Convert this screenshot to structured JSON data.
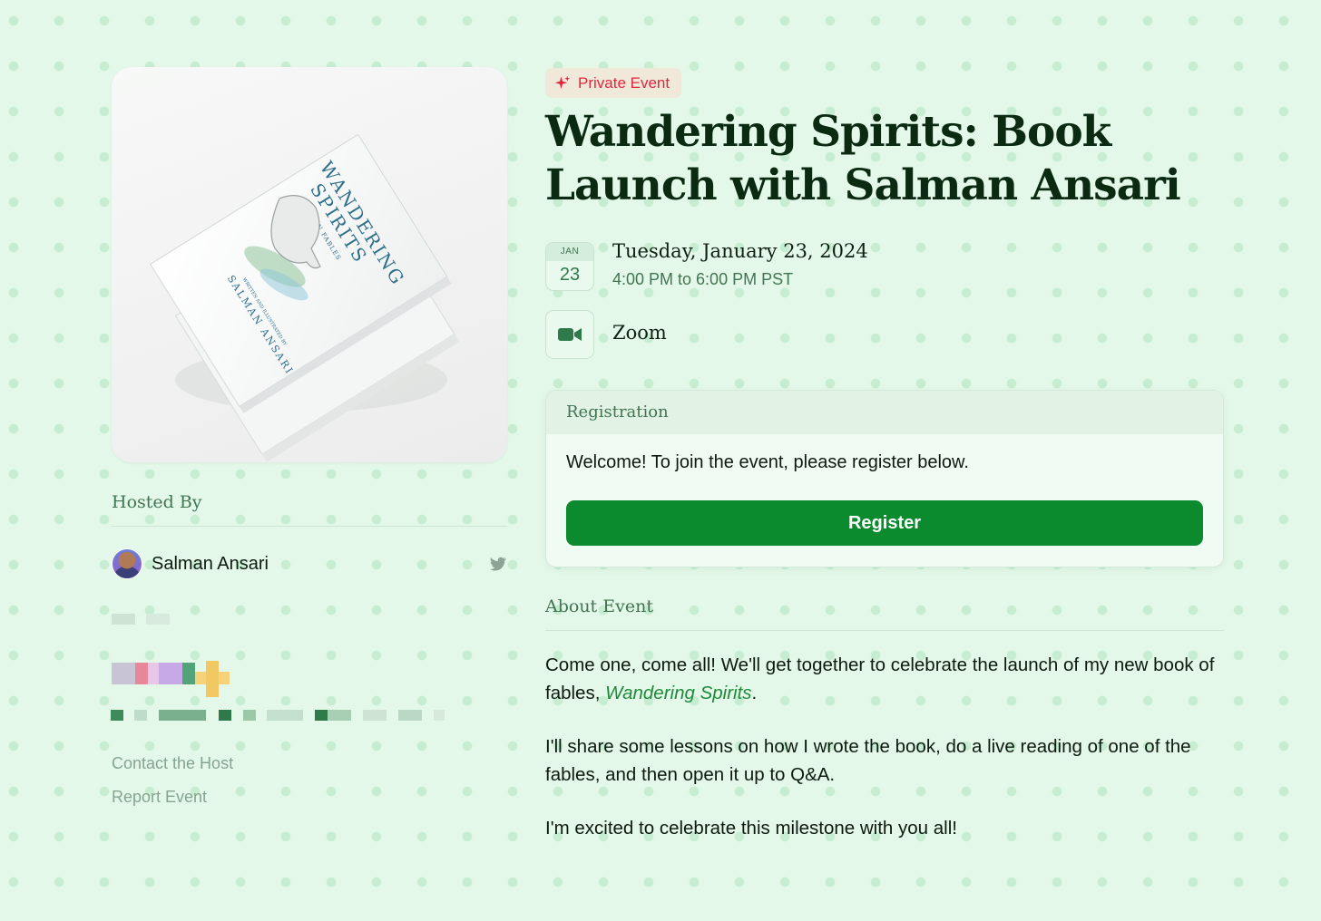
{
  "cover": {
    "book_title_line1": "WANDERING",
    "book_title_line2": "SPIRITS",
    "book_subtitle": "MODERN FABLES",
    "book_byline": "WRITTEN AND ILLUSTRATED BY",
    "book_author": "SALMAN ANSARI"
  },
  "host": {
    "section_label": "Hosted By",
    "name": "Salman Ansari",
    "social_icon": "twitter-icon"
  },
  "links": {
    "contact": "Contact the Host",
    "report": "Report Event"
  },
  "event": {
    "badge": "Private Event",
    "badge_icon": "sparkle-icon",
    "title": "Wandering Spirits: Book Launch with Salman Ansari",
    "calendar_month": "JAN",
    "calendar_day": "23",
    "date": "Tuesday, January 23, 2024",
    "time": "4:00 PM to 6:00 PM PST",
    "location": "Zoom",
    "location_icon": "video-camera-icon"
  },
  "registration": {
    "header": "Registration",
    "message": "Welcome! To join the event, please register below.",
    "button": "Register"
  },
  "about": {
    "section_label": "About Event",
    "p1_before": "Come one, come all! We'll get together to celebrate the launch of my new book of fables, ",
    "p1_link": "Wandering Spirits",
    "p1_after": ".",
    "p2": "I'll share some lessons on how I wrote the book, do a live reading of one of the fables, and then open it up to Q&A.",
    "p3": "I'm excited to celebrate this milestone with you all!"
  },
  "colors": {
    "background": "#e4f8e9",
    "accent_green": "#0b8a2e",
    "badge_red": "#e0283d"
  }
}
